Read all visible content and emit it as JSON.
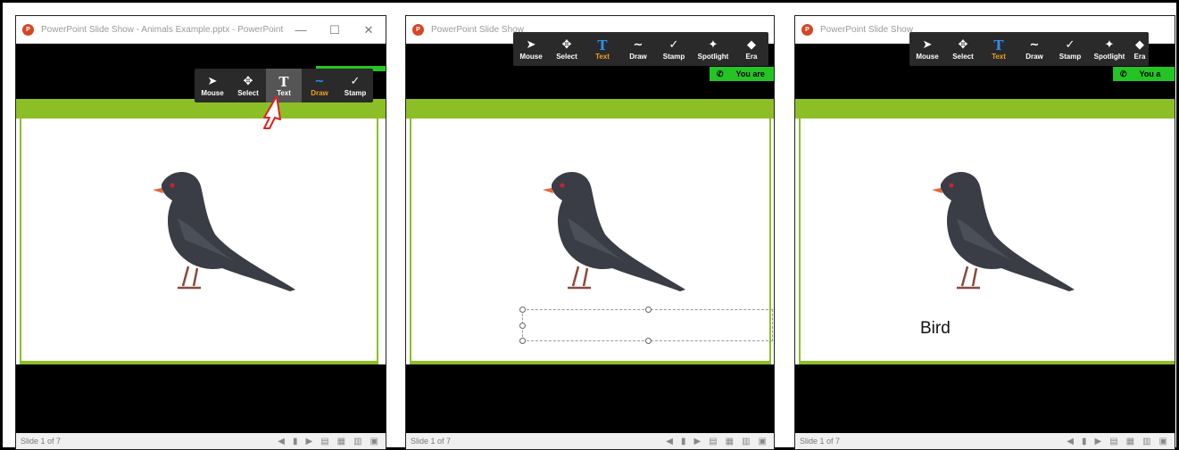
{
  "window": {
    "title_full": "PowerPoint Slide Show  -  Animals Example.pptx  -  PowerPoint",
    "title_short": "PowerPoint Slide Show",
    "app_icon": "powerpoint-icon",
    "controls": {
      "minimize": "—",
      "maximize": "☐",
      "close": "✕"
    }
  },
  "status": {
    "slide_indicator": "Slide 1 of 7"
  },
  "toolbar": {
    "tools": [
      {
        "label": "Mouse",
        "icon": "cursor-arrow-icon",
        "glyph": "➤"
      },
      {
        "label": "Select",
        "icon": "move-arrows-icon",
        "glyph": "✥"
      },
      {
        "label": "Text",
        "icon": "text-t-icon",
        "glyph": "T"
      },
      {
        "label": "Draw",
        "icon": "squiggle-icon",
        "glyph": "∼"
      },
      {
        "label": "Stamp",
        "icon": "checkmark-icon",
        "glyph": "✓"
      },
      {
        "label": "Spotlight",
        "icon": "magic-wand-icon",
        "glyph": "✦"
      },
      {
        "label": "Era",
        "icon": "eraser-icon",
        "glyph": "◆"
      }
    ]
  },
  "share_notice": {
    "text": "You are",
    "text_short": "You a",
    "icon": "phone-icon"
  },
  "slide": {
    "text_label": "Bird"
  },
  "colors": {
    "accent_green": "#8cbf26",
    "share_green": "#25c425",
    "toolbar_bg": "#2a2a2a",
    "active_blue": "#2f8ef4",
    "active_orange": "#f0a020"
  }
}
